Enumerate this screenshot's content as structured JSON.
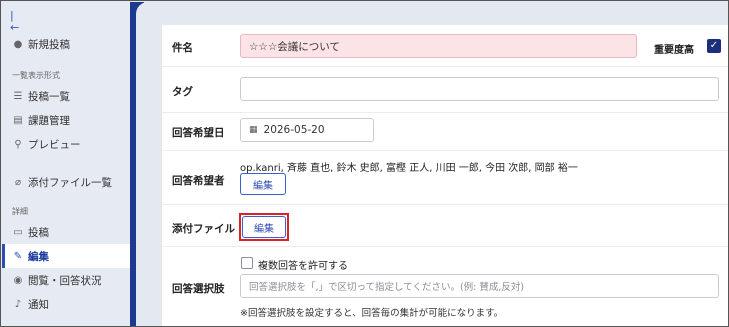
{
  "sidebar": {
    "collapse_icon": "collapse-left-icon",
    "new_post": "新規投稿",
    "section_list_format": "一覧表示形式",
    "post_list": "投稿一覧",
    "task_management": "課題管理",
    "preview": "プレビュー",
    "attachments_list": "添付ファイル一覧",
    "section_details": "詳細",
    "post": "投稿",
    "edit": "編集",
    "view_reply_status": "閲覧・回答状況",
    "notification": "通知"
  },
  "form": {
    "subject_label": "件名",
    "subject_value": "☆☆☆会議について",
    "important_label": "重要度高",
    "important_checked": true,
    "tag_label": "タグ",
    "tag_value": "",
    "due_date_label": "回答希望日",
    "due_date_value": "2026-05-20",
    "respondents_label": "回答希望者",
    "respondents_value": "op.kanri, 斉藤 直也, 鈴木 史郎, 富樫 正人, 川田 一郎, 今田 次郎, 岡部 裕一",
    "respondents_edit": "編集",
    "attachment_label": "添付ファイル",
    "attachment_edit": "編集",
    "choices_label": "回答選択肢",
    "allow_multiple": "複数回答を許可する",
    "choices_placeholder": "回答選択肢を「,」で区切って指定してください。(例: 賛成,反対)",
    "choices_note": "※回答選択肢を設定すると、回答毎の集計が可能になります。"
  },
  "colors": {
    "accent": "#2f4bb5",
    "sidebar_dark": "#1d3a8f",
    "highlight": "#d8232a",
    "subject_bg": "#fbe3e6"
  }
}
